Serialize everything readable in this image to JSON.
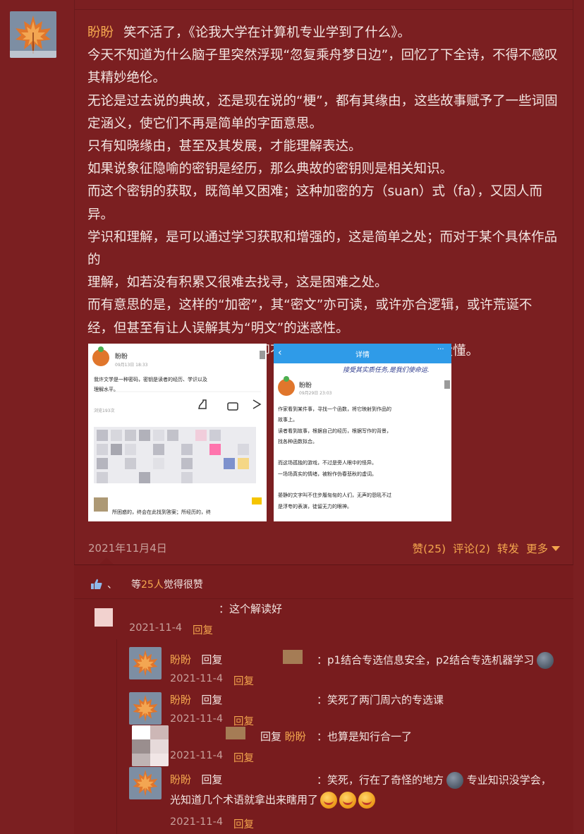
{
  "post": {
    "author": "盼盼",
    "lines": [
      "笑不活了，《论我大学在计算机专业学到了什么》。",
      "今天不知道为什么脑子里突然浮现“忽复乘舟梦日边”，回忆了下全诗，不得不感叹",
      "其精妙绝伦。",
      "无论是过去说的典故，还是现在说的“梗”，都有其缘由，这些故事赋予了一些词固",
      "定涵义，使它们不再是简单的字面意思。",
      "只有知晓缘由，甚至及其发展，才能理解表达。",
      "如果说象征隐喻的密钥是经历，那么典故的密钥则是相关知识。",
      "而这个密钥的获取，既简单又困难；这种加密的方（suan）式（fa），又因人而",
      "异。",
      "学识和理解，是可以通过学习获取和增强的，这是简单之处；而对于某个具体作品的",
      "理解，如若没有积累又很难去找寻，这是困难之处。",
      "而有意思的是，这样的“加密”，其“密文”亦可读，或许亦合逻辑，或许荒诞不",
      "经，但甚至有让人误解其为“明文”的迷惑性。",
      "或者是，明明每个字都认识，却不明就里。仿佛懂了，又似乎没懂。"
    ],
    "date": "2021年11月4日",
    "actions": {
      "like": "赞(25)",
      "comment": "评论(2)",
      "forward": "转发",
      "more": "更多"
    }
  },
  "image1": {
    "user": "盼盼",
    "time": "09月13日 18:33",
    "text_lines": [
      "我许文学是一种密码，密钥是读者的经历、学识以及",
      "理解水平。"
    ],
    "views": "浏览193次",
    "bottom_text": "所困惑的，终会在此找到答案；所经历的，终"
  },
  "image2": {
    "header_title": "详情",
    "banner": "接受其实质任务,是我们使命运.",
    "user": "盼盼",
    "time": "09月29日 23:03",
    "text_lines": [
      "作家看到某件事，寻找一个函数，将它映射到作品的",
      "故事上。",
      "读者看到故事，根据自己的经历，根据写作的背景，",
      "找各种函数拟合。",
      "",
      "而这场孤独的游戏，不过是旁人眼中的怪异。",
      "一场场真实的情绪，被粉作伪春悲秋的虚词。",
      "",
      "晏静的文字叫不住步履匆匆的人们，无声的怨吼不过",
      "是浮夸的表演，徒留无力的眼神。"
    ]
  },
  "likes": {
    "separator": "、",
    "prefix": "等",
    "count": "25人",
    "suffix": "觉得很赞"
  },
  "comments": [
    {
      "text": "：这个解读好",
      "date": "2021-11-4",
      "reply": "回复"
    },
    {
      "author": "盼盼",
      "reply_word": "回复",
      "text": "：p1结合专选信息安全，p2结合专选机器学习",
      "date": "2021-11-4",
      "reply": "回复"
    },
    {
      "author": "盼盼",
      "reply_word": "回复",
      "text": "：笑死了两门周六的专选课",
      "date": "2021-11-4",
      "reply": "回复"
    },
    {
      "reply_word": "回复",
      "target": "盼盼",
      "text": "：也算是知行合一了",
      "date": "2021-11-4",
      "reply": "回复"
    },
    {
      "author": "盼盼",
      "reply_word": "回复",
      "text_a": "：笑死，行在了奇怪的地方",
      "text_b": "专业知识没学会，",
      "text_c": "光知道几个术语就拿出来瞎用了",
      "date": "2021-11-4",
      "reply": "回复"
    }
  ]
}
